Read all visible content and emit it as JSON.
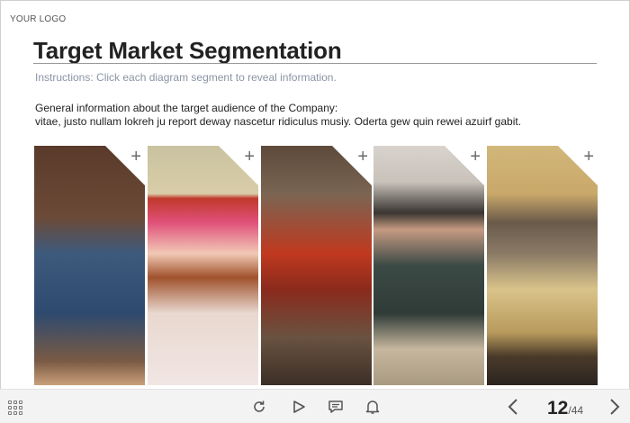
{
  "header": {
    "logo": "YOUR LOGO",
    "title": "Target Market Segmentation",
    "instructions": "Instructions: Click each diagram segment to reveal information."
  },
  "info": {
    "line1": "General information about the target audience of the Company:",
    "line2": "vitae, justo nullam lokreh ju report deway nascetur ridiculus musiy. Oderta gew quin rewei azuirf gabit."
  },
  "segments": [
    {
      "plus": "+"
    },
    {
      "plus": "+"
    },
    {
      "plus": "+"
    },
    {
      "plus": "+"
    },
    {
      "plus": "+"
    }
  ],
  "player": {
    "current_page": "12",
    "separator": "/",
    "total_pages": "44"
  },
  "icons": [
    "grid-menu-icon",
    "replay-icon",
    "play-icon",
    "chat-icon",
    "bell-icon",
    "chevron-left-icon",
    "chevron-right-icon"
  ]
}
